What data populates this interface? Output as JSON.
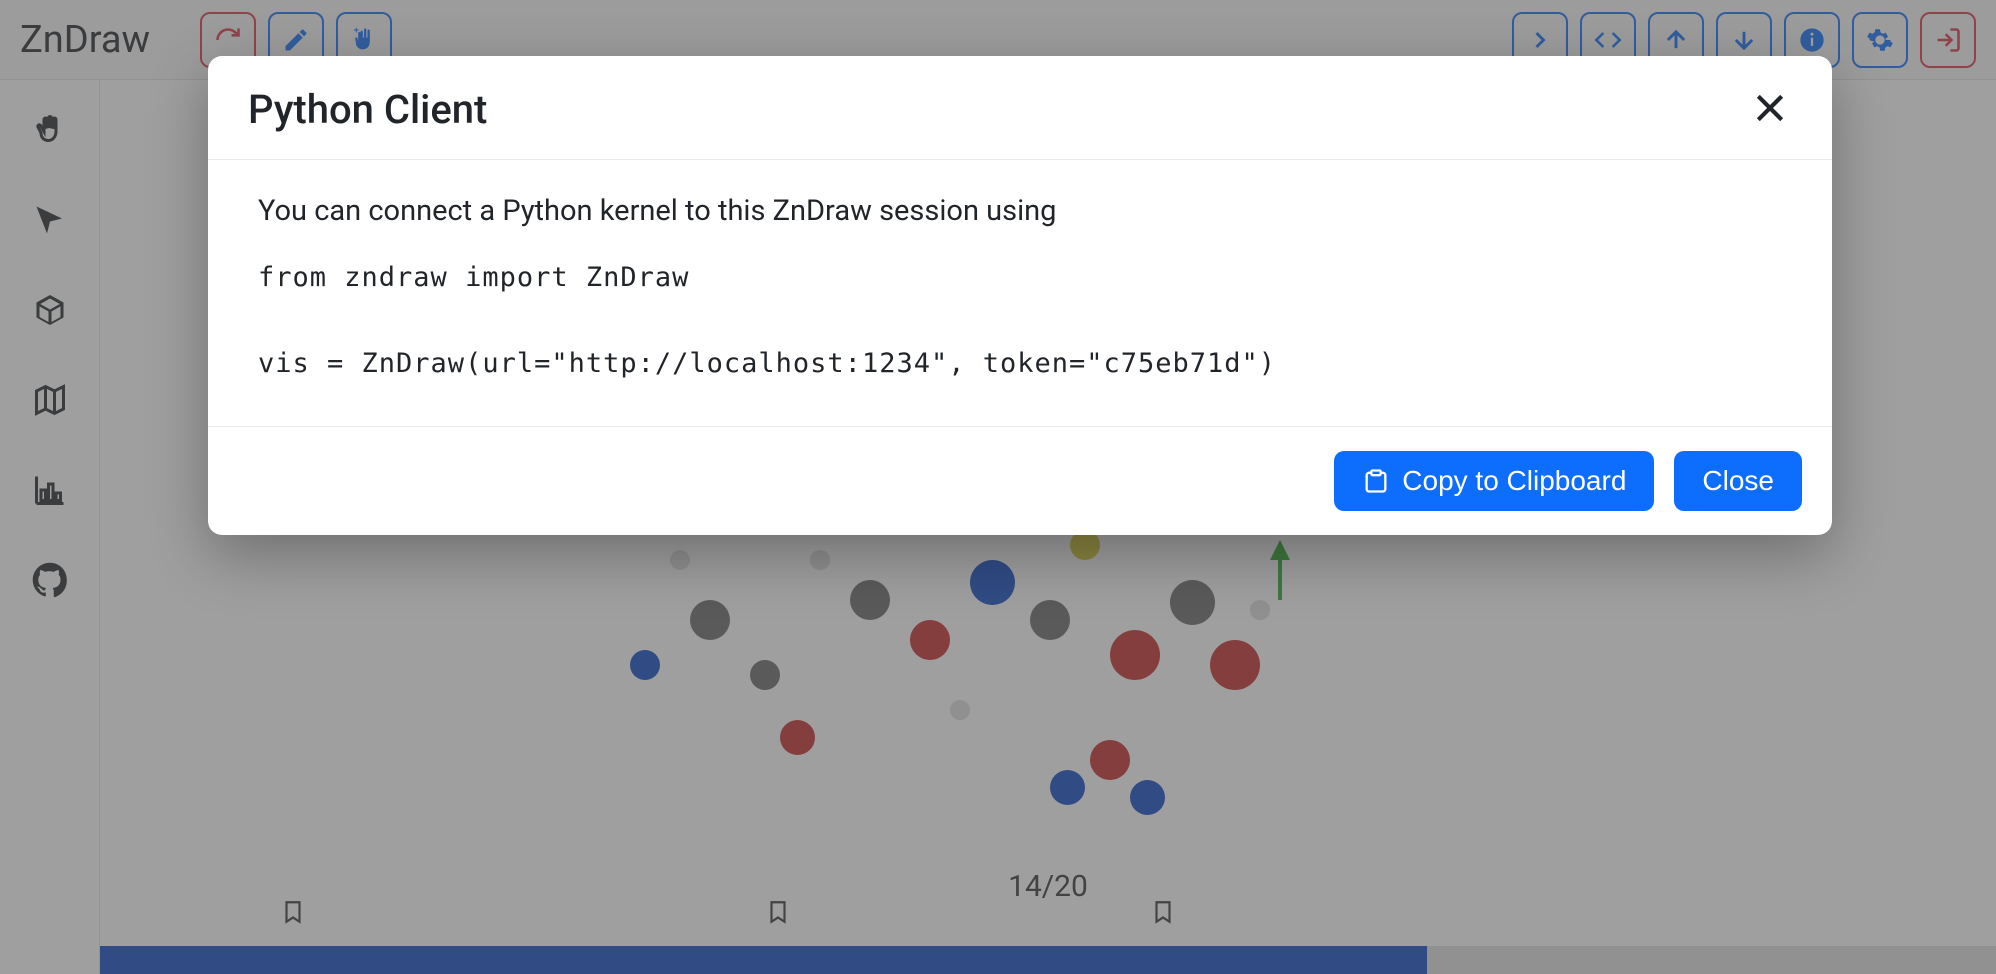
{
  "header": {
    "brand": "ZnDraw"
  },
  "modal": {
    "title": "Python Client",
    "description": "You can connect a Python kernel to this ZnDraw session using",
    "code_line1": "from zndraw import ZnDraw",
    "code_line2": "vis = ZnDraw(url=\"http://localhost:1234\", token=\"c75eb71d\")",
    "copy_label": "Copy to Clipboard",
    "close_label": "Close"
  },
  "frames": {
    "current": 14,
    "total": 20,
    "display": "14/20"
  },
  "progress": {
    "percent": 70
  }
}
